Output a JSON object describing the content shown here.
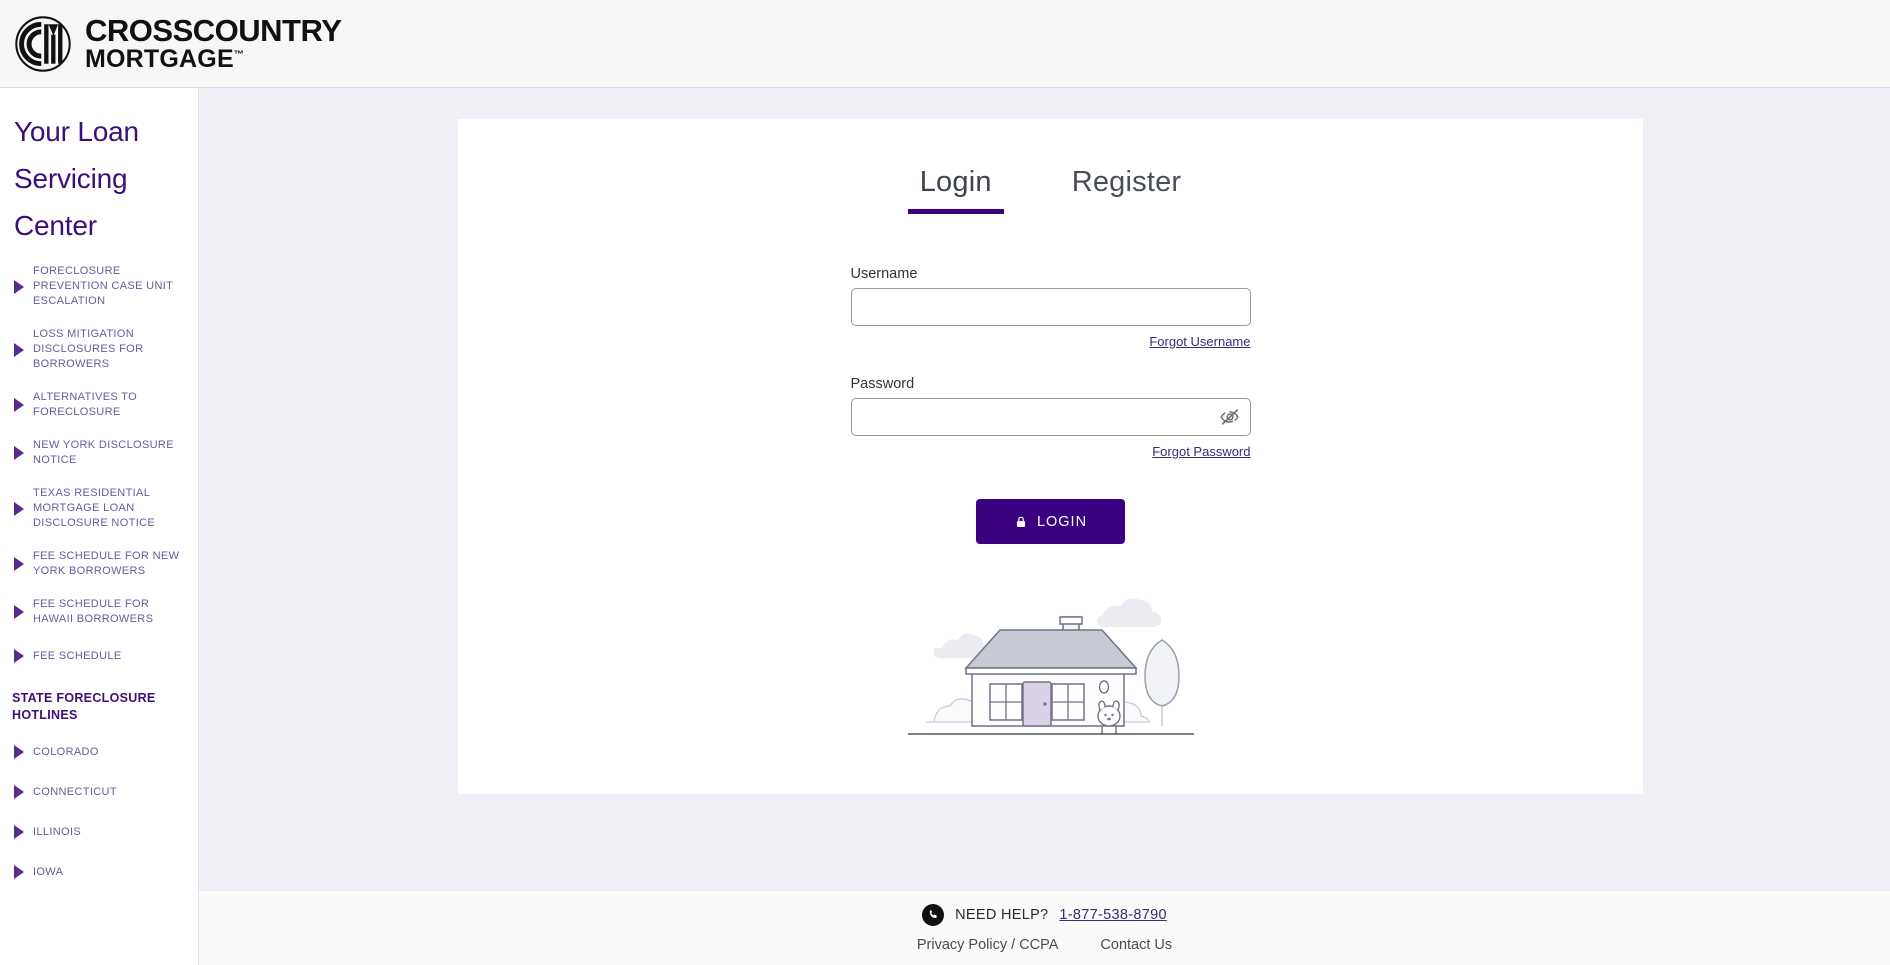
{
  "header": {
    "logo_icon": "ccm-circle-logo",
    "brand_line1": "CROSSCOUNTRY",
    "brand_line2": "MORTGAGE",
    "brand_tm": "™"
  },
  "sidebar": {
    "title": "Your Loan Servicing Center",
    "items": [
      {
        "label": "FORECLOSURE PREVENTION CASE UNIT ESCALATION",
        "type": "link"
      },
      {
        "label": "LOSS MITIGATION DISCLOSURES FOR BORROWERS",
        "type": "link"
      },
      {
        "label": "ALTERNATIVES TO FORECLOSURE",
        "type": "link"
      },
      {
        "label": "NEW YORK DISCLOSURE NOTICE",
        "type": "link"
      },
      {
        "label": "TEXAS RESIDENTIAL MORTGAGE LOAN DISCLOSURE NOTICE",
        "type": "link"
      },
      {
        "label": "FEE SCHEDULE FOR NEW YORK BORROWERS",
        "type": "link"
      },
      {
        "label": "FEE SCHEDULE FOR HAWAII BORROWERS",
        "type": "link"
      },
      {
        "label": "FEE SCHEDULE",
        "type": "link"
      },
      {
        "label": "STATE FORECLOSURE HOTLINES",
        "type": "section"
      },
      {
        "label": "COLORADO",
        "type": "link"
      },
      {
        "label": "CONNECTICUT",
        "type": "link"
      },
      {
        "label": "ILLINOIS",
        "type": "link"
      },
      {
        "label": "IOWA",
        "type": "link"
      }
    ]
  },
  "main": {
    "tabs": [
      {
        "label": "Login",
        "active": true
      },
      {
        "label": "Register",
        "active": false
      }
    ],
    "form": {
      "username_label": "Username",
      "username_value": "",
      "username_placeholder": "",
      "forgot_username_label": "Forgot Username",
      "password_label": "Password",
      "password_value": "",
      "password_placeholder": "",
      "forgot_password_label": "Forgot Password",
      "toggle_password_icon": "eye-slash-icon",
      "login_button_label": "LOGIN",
      "login_button_icon": "lock-icon"
    },
    "illustration": "house-with-tree-and-dog-line-art"
  },
  "footer": {
    "phone_icon": "phone-icon",
    "need_help_label": "NEED HELP?",
    "phone_number": "1-877-538-8790",
    "links": [
      {
        "label": "Privacy Policy / CCPA"
      },
      {
        "label": "Contact Us"
      }
    ]
  },
  "colors": {
    "brand_purple": "#3A0080",
    "sidebar_title_purple": "#3C0F78",
    "nav_text_purple": "#6A5A9A",
    "page_background": "#EEF0F5",
    "card_background": "#FFFFFF",
    "header_background": "#F7F7F7",
    "footer_background": "#FAFAFA"
  }
}
